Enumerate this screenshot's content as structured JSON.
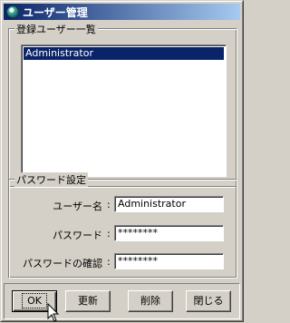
{
  "window": {
    "title": "ユーザー管理",
    "icon": "app-globe-icon",
    "titlebar_colors": [
      "#0a246a",
      "#a6caf0"
    ]
  },
  "users_group": {
    "label": "登録ユーザー一覧",
    "items": [
      {
        "name": "Administrator",
        "selected": true
      }
    ]
  },
  "password_group": {
    "label": "パスワード設定",
    "fields": [
      {
        "label": "ユーザー名",
        "colon": ":",
        "value": "Administrator"
      },
      {
        "label": "パスワード",
        "colon": ":",
        "value": "********"
      },
      {
        "label": "パスワードの確認",
        "colon": ":",
        "value": "********"
      }
    ]
  },
  "buttons": {
    "ok": "OK",
    "update": "更新",
    "delete": "削除",
    "close": "閉じる"
  }
}
